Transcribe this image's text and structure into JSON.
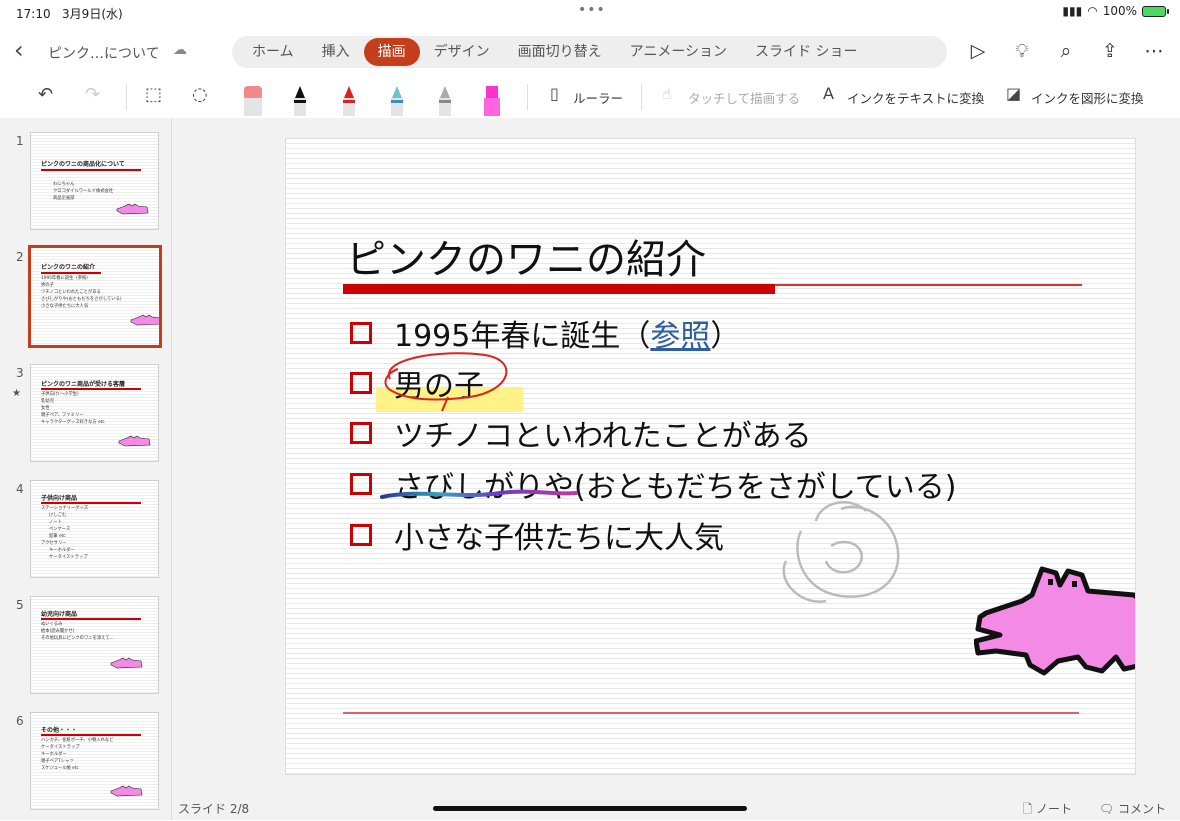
{
  "status": {
    "time": "17:10",
    "date": "3月9日(水)",
    "battery": "100%"
  },
  "doc": {
    "title": "ピンク…について"
  },
  "tabs": [
    "ホーム",
    "挿入",
    "描画",
    "デザイン",
    "画面切り替え",
    "アニメーション",
    "スライド ショー"
  ],
  "active_tab": "描画",
  "ribbon": {
    "ruler": "ルーラー",
    "touch_draw": "タッチして描画する",
    "ink_to_text": "インクをテキストに変換",
    "ink_to_shape": "インクを図形に変換"
  },
  "pens": [
    {
      "color": "#f08a8a",
      "name": "eraser"
    },
    {
      "color": "#111111",
      "name": "black-pen"
    },
    {
      "color": "#dd2222",
      "name": "red-pen"
    },
    {
      "color": "#6fbfd0",
      "name": "galaxy-pen"
    },
    {
      "color": "#aaaaaa",
      "name": "pencil"
    },
    {
      "color": "#ff33cc",
      "name": "highlighter"
    }
  ],
  "slides": [
    {
      "num": "1",
      "title": "ピンクのワニの商品化について",
      "lines": [
        "わにちゃん",
        "クロコダイルワールド株式会社",
        "商品企画部"
      ]
    },
    {
      "num": "2",
      "title": "ピンクのワニの紹介",
      "lines": [
        "1995年春に誕生（参照）",
        "男の子",
        "ツチノコといわれたことがある",
        "さびしがりや(おともだちをさがしている)",
        "小さな子供たちに大人気"
      ]
    },
    {
      "num": "3",
      "title": "ピンクのワニ商品が受ける客層",
      "lines": [
        "子供向け(〜小学生)",
        "乳幼児",
        "女性",
        "親子ペア、ファミリー",
        "キャラクターグッズ好きな方 etc"
      ]
    },
    {
      "num": "4",
      "title": "子供向け商品",
      "lines": [
        "ステーショナリーグッズ",
        "けしごむ",
        "ノート",
        "ペンケース",
        "鉛筆 etc",
        "アクセサリー",
        "キーホルダー",
        "ケータイストラップ"
      ]
    },
    {
      "num": "5",
      "title": "幼児向け商品",
      "lines": [
        "ぬいぐるみ",
        "絵本(読み聞かせ)",
        "その他玩具にピンクのワニを添えて..."
      ]
    },
    {
      "num": "6",
      "title": "その他・・・",
      "lines": [
        "ハンカチ、化粧ポーチ、小物入れなど",
        "ケータイストラップ",
        "キーホルダー",
        "親子ペアTシャツ",
        "スケジュール帳 etc"
      ]
    }
  ],
  "current": {
    "title": "ピンクのワニの紹介",
    "b1_pre": "1995年春に誕生（",
    "b1_link": "参照",
    "b1_post": "）",
    "b2": "男の子",
    "b3": "ツチノコといわれたことがある",
    "b4": "さびしがりや(おともだちをさがしている)",
    "b5": "小さな子供たちに大人気"
  },
  "footer": {
    "slide_indicator": "スライド 2/8",
    "notes": "ノート",
    "comments": "コメント"
  },
  "colors": {
    "accent": "#c43e1c",
    "croc": "#f38be6"
  }
}
